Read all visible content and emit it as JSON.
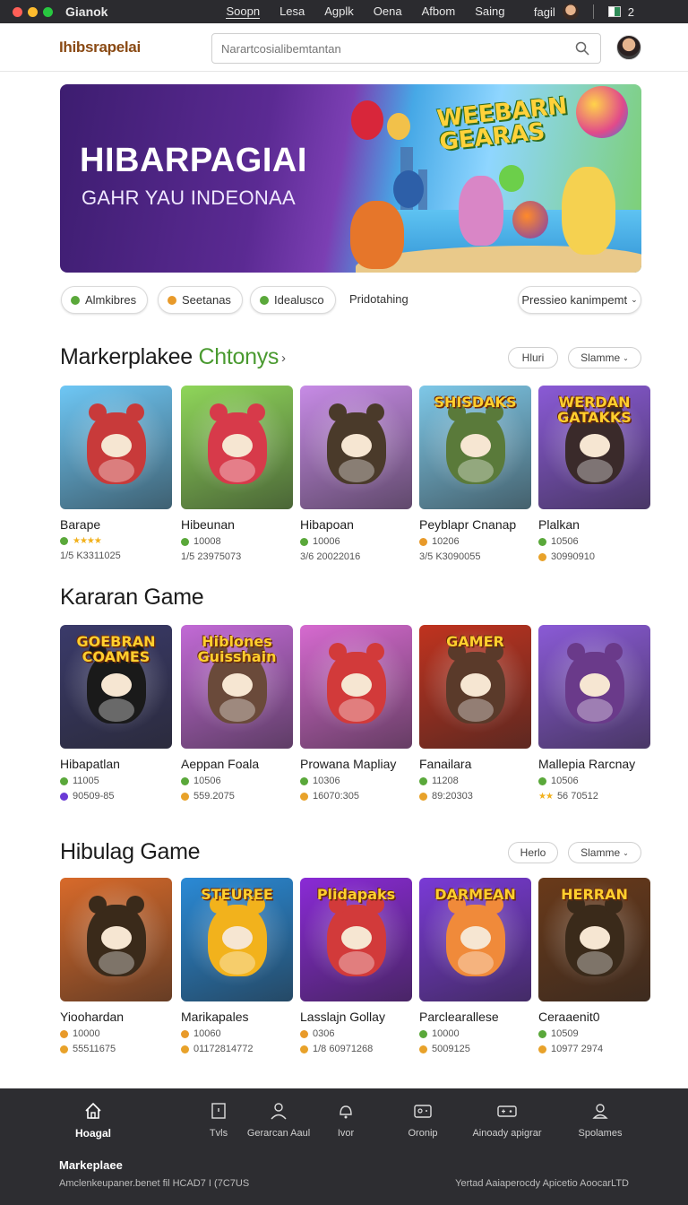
{
  "os_bar": {
    "app_name": "Gianok",
    "menu": [
      "Soopn",
      "Lesa",
      "Agplk",
      "Oena",
      "Afbom",
      "Saing"
    ],
    "user_label": "fagil",
    "badge": "2"
  },
  "header": {
    "logo": "Ihibsrapelai",
    "search_placeholder": "Narartcosialibemtantan"
  },
  "hero": {
    "title": "HIBARPAGIAI",
    "subtitle": "GAHR YAU INDEONAA",
    "art_title": "WEEBARN GEARAS"
  },
  "filters": {
    "chips": [
      {
        "label": "Almkibres",
        "color": "#5aa83a"
      },
      {
        "label": "Seetanas",
        "color": "#e89a2a"
      },
      {
        "label": "Idealusco",
        "color": "#5aa83a"
      }
    ],
    "plain": "Pridotahing",
    "sort": "Pressieo kanimpemt"
  },
  "sections": [
    {
      "title": "Markerplakee",
      "accent": "Chtonys",
      "pill_left": "Hluri",
      "pill_right": "Slamme",
      "cards": [
        {
          "name": "Barape",
          "meta1": "",
          "stars": "★★★★",
          "meta2": "1/5 K3311025",
          "art": ""
        },
        {
          "name": "Hibeunan",
          "meta1": "10008",
          "stars": "",
          "meta2": "1/5 23975073",
          "art": ""
        },
        {
          "name": "Hibapoan",
          "meta1": "10006",
          "stars": "",
          "meta2": "3/6 20022016",
          "art": ""
        },
        {
          "name": "Peyblapr Cnanap",
          "meta1": "10206",
          "stars": "",
          "meta2": "3/5 K3090055",
          "art": "SHISDAKS"
        },
        {
          "name": "Plalkan",
          "meta1": "10506",
          "stars": "",
          "meta2": "30990910",
          "art": "WERDAN GATAKKS"
        }
      ]
    },
    {
      "title": "Kararan Game",
      "cards": [
        {
          "name": "Hibapatlan",
          "meta1": "11005",
          "stars": "",
          "meta2": "90509-85",
          "art": "GOEBRAN COAMES"
        },
        {
          "name": "Aeppan Foala",
          "meta1": "10506",
          "stars": "",
          "meta2": "559.2075",
          "art": "Hiblones Guisshain"
        },
        {
          "name": "Prowana  Mapliay",
          "meta1": "10306",
          "stars": "",
          "meta2": "16070:305",
          "art": ""
        },
        {
          "name": "Fanailara",
          "meta1": "11208",
          "stars": "",
          "meta2": "89:20303",
          "art": "GAMER"
        },
        {
          "name": "Mallepia Rarcnay",
          "meta1": "10506",
          "stars": "★★",
          "meta2": "56 70512",
          "art": ""
        }
      ]
    },
    {
      "title": "Hibulag Game",
      "pill_left": "Herlo",
      "pill_right": "Slamme",
      "cards": [
        {
          "name": "Yioohardan",
          "meta1": "10000",
          "stars": "",
          "meta2": "55511675",
          "art": ""
        },
        {
          "name": "Marikapales",
          "meta1": "10060",
          "stars": "",
          "meta2": "01172814772",
          "art": "STEUREE"
        },
        {
          "name": "Lasslajn Gollay",
          "meta1": "0306",
          "stars": "",
          "meta2": "1/8 60971268",
          "art": "Plidapaks"
        },
        {
          "name": "Parclearallese",
          "meta1": "10000",
          "stars": "",
          "meta2": "5009125",
          "art": "DARMEAN"
        },
        {
          "name": "Ceraaenit0",
          "meta1": "10509",
          "stars": "",
          "meta2": "10977 2974",
          "art": "HERRAN"
        }
      ]
    }
  ],
  "bottom_nav": {
    "items": [
      {
        "label": "Hoagal",
        "icon": "home-icon"
      },
      {
        "label": "Tvls",
        "icon": "square-icon"
      },
      {
        "label": "Gerarcan Aaul",
        "icon": "person-icon"
      },
      {
        "label": "Ivor",
        "icon": "bell-icon"
      },
      {
        "label": "Oronip",
        "icon": "gamepad-icon"
      },
      {
        "label": "Ainoady apigrar",
        "icon": "controller-icon"
      },
      {
        "label": "Spolames",
        "icon": "user-icon"
      }
    ],
    "brand": "Markeplaee",
    "left_text": "Amclenkeupaner.benet fil HCAD7 I  (7C7US",
    "right_text": "Yertad Aaiaperocdy  Apicetio AoocarLTD"
  },
  "colors": {
    "accent_green": "#4a9a30",
    "dark_bar": "#2d2d31"
  }
}
